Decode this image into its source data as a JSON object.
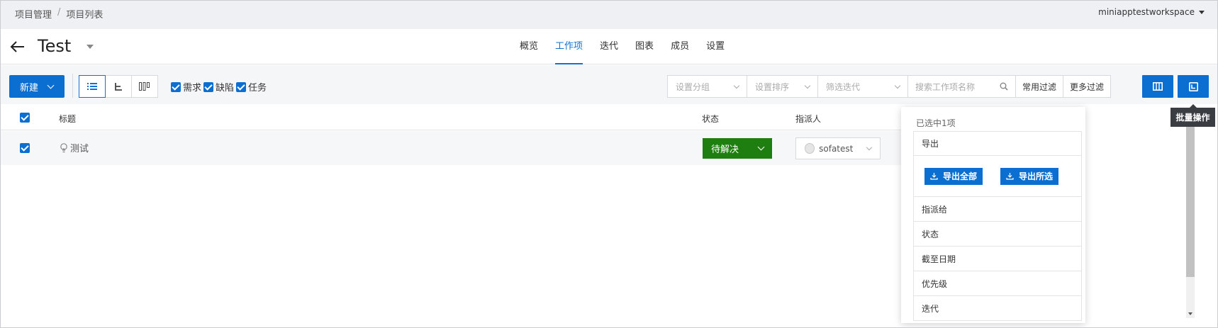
{
  "breadcrumb": {
    "items": [
      "项目管理",
      "项目列表"
    ],
    "separator": "/"
  },
  "workspace": "miniapptestworkspace",
  "project": {
    "title": "Test"
  },
  "tabs": [
    {
      "label": "概览",
      "active": false
    },
    {
      "label": "工作项",
      "active": true
    },
    {
      "label": "迭代",
      "active": false
    },
    {
      "label": "图表",
      "active": false
    },
    {
      "label": "成员",
      "active": false
    },
    {
      "label": "设置",
      "active": false
    }
  ],
  "toolbar": {
    "new_label": "新建",
    "type_filters": [
      {
        "label": "需求",
        "checked": true
      },
      {
        "label": "缺陷",
        "checked": true
      },
      {
        "label": "任务",
        "checked": true
      }
    ],
    "group_placeholder": "设置分组",
    "sort_placeholder": "设置排序",
    "iteration_placeholder": "筛选迭代",
    "search_placeholder": "搜索工作项名称",
    "common_filter_label": "常用过滤",
    "more_filter_label": "更多过滤",
    "batch_tooltip": "批量操作"
  },
  "table": {
    "headers": {
      "title": "标题",
      "status": "状态",
      "assignee": "指派人"
    },
    "rows": [
      {
        "checked": true,
        "type_icon": "bulb-icon",
        "title": "测试",
        "status": "待解决",
        "assignee": "sofatest"
      }
    ]
  },
  "batch_panel": {
    "selected_text": "已选中1项",
    "export_label": "导出",
    "export_all_label": "导出全部",
    "export_selected_label": "导出所选",
    "items": [
      "指派给",
      "状态",
      "截至日期",
      "优先级",
      "迭代"
    ]
  },
  "colors": {
    "primary": "#0b6fd1",
    "status_green": "#1e7e0f",
    "tooltip_bg": "#3a3d42"
  }
}
